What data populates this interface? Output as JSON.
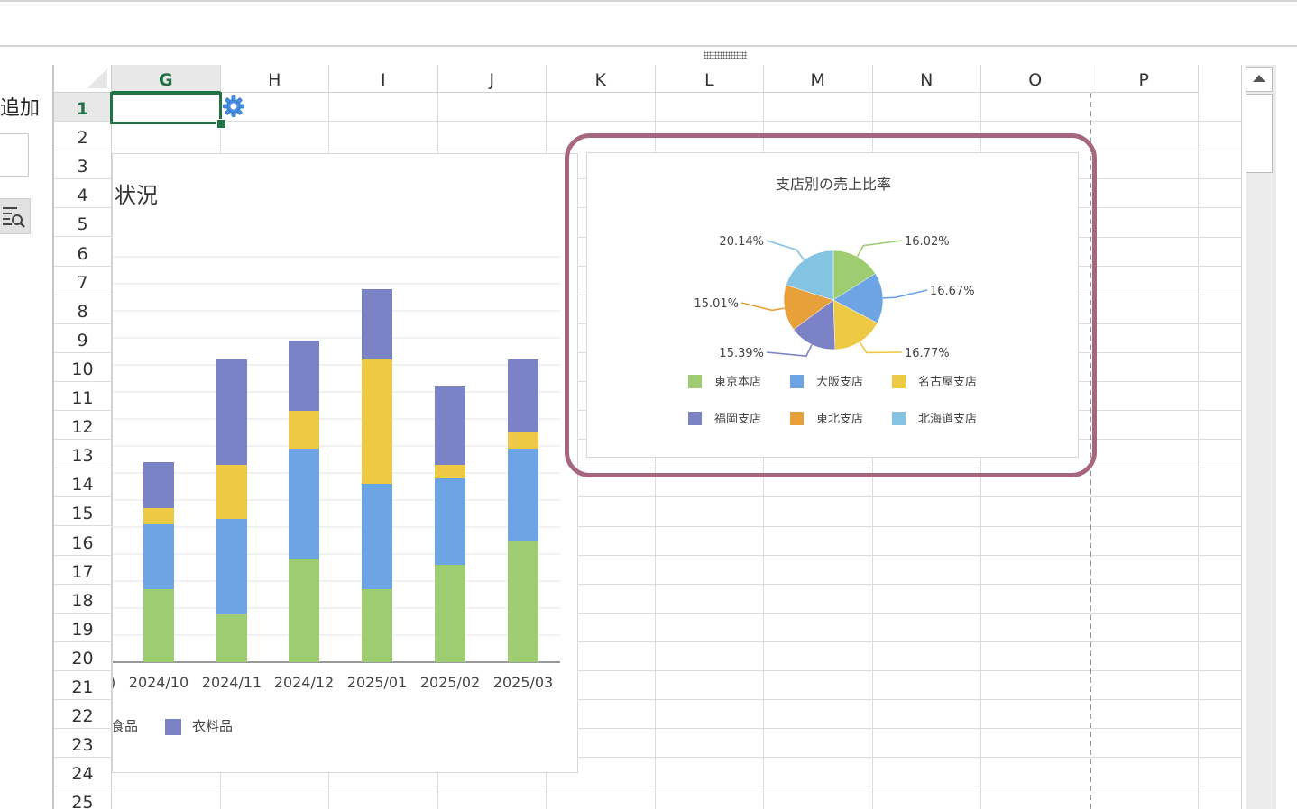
{
  "left_panel": {
    "label": "追加"
  },
  "grid": {
    "columns": [
      "G",
      "H",
      "I",
      "J",
      "K",
      "L",
      "M",
      "N",
      "O",
      "P"
    ],
    "selected_column": "G",
    "rows": [
      1,
      2,
      3,
      4,
      5,
      6,
      7,
      8,
      9,
      10,
      11,
      12,
      13,
      14,
      15,
      16,
      17,
      18,
      19,
      20,
      21,
      22,
      23,
      24,
      25
    ],
    "selected_row": 1
  },
  "bar_chart": {
    "title_visible": "状況",
    "categories": [
      "2024/10",
      "2024/11",
      "2024/12",
      "2025/01",
      "2025/02",
      "2025/03"
    ],
    "partial_left_tick": ")",
    "legend_partial": [
      {
        "label": "食品",
        "color": "#eeca44",
        "clipped": true
      },
      {
        "label": "衣料品",
        "color": "#7b82c6"
      }
    ]
  },
  "chart_data": [
    {
      "type": "bar",
      "stacked": true,
      "title": "",
      "categories": [
        "2024/10",
        "2024/11",
        "2024/12",
        "2025/01",
        "2025/02",
        "2025/03"
      ],
      "series": [
        {
          "color": "#9dcd70",
          "values": [
            27,
            18,
            38,
            27,
            36,
            45
          ]
        },
        {
          "color": "#6ca4e4",
          "values": [
            24,
            35,
            41,
            39,
            32,
            34
          ]
        },
        {
          "color": "#eeca44",
          "values": [
            6,
            20,
            14,
            46,
            5,
            6
          ]
        },
        {
          "name": "衣料品",
          "color": "#7b82c6",
          "values": [
            17,
            39,
            26,
            26,
            29,
            27
          ]
        }
      ],
      "ylim": [
        0,
        150
      ],
      "grid": true
    },
    {
      "type": "pie",
      "title": "支店別の売上比率",
      "slices": [
        {
          "label": "東京本店",
          "value": 16.02,
          "display": "16.02%",
          "color": "#9dcd70"
        },
        {
          "label": "大阪支店",
          "value": 16.67,
          "display": "16.67%",
          "color": "#6ca4e4"
        },
        {
          "label": "名古屋支店",
          "value": 16.77,
          "display": "16.77%",
          "color": "#eeca44"
        },
        {
          "label": "福岡支店",
          "value": 15.39,
          "display": "15.39%",
          "color": "#7b82c6"
        },
        {
          "label": "東北支店",
          "value": 15.01,
          "display": "15.01%",
          "color": "#e8a03a"
        },
        {
          "label": "北海道支店",
          "value": 20.14,
          "display": "20.14%",
          "color": "#84c3e2"
        }
      ],
      "legend": "bottom"
    }
  ]
}
